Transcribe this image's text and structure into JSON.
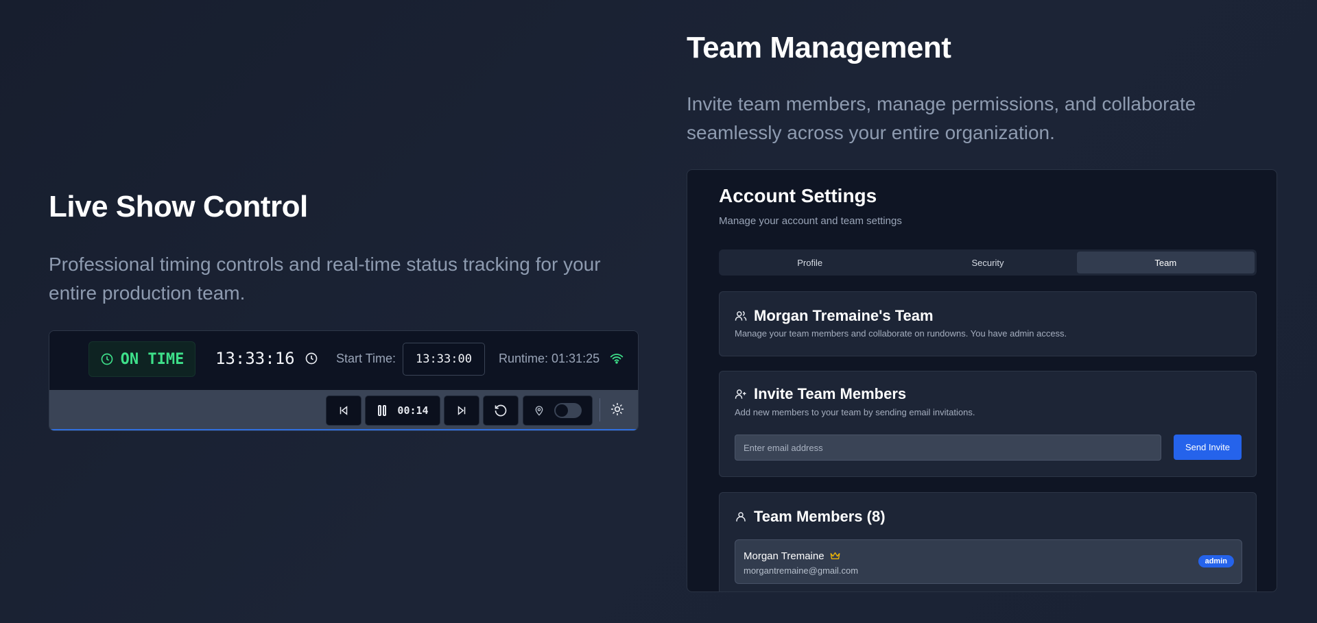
{
  "left": {
    "title": "Live Show Control",
    "description": "Professional timing controls and real-time status tracking for your entire production team.",
    "control": {
      "status": "ON TIME",
      "clock": "13:33:16",
      "start_label": "Start Time:",
      "start_value": "13:33:00",
      "runtime": "Runtime: 01:31:25",
      "timer": "00:14",
      "status_color": "#3ee08a"
    }
  },
  "right": {
    "title": "Team Management",
    "description": "Invite team members, manage permissions, and collaborate seamlessly across your entire organization.",
    "panel": {
      "title": "Account Settings",
      "subtitle": "Manage your account and team settings",
      "tabs": [
        {
          "label": "Profile"
        },
        {
          "label": "Security"
        },
        {
          "label": "Team"
        }
      ],
      "active_tab": "Team",
      "team_card": {
        "title": "Morgan Tremaine's Team",
        "description": "Manage your team members and collaborate on rundowns. You have admin access."
      },
      "invite_card": {
        "title": "Invite Team Members",
        "description": "Add new members to your team by sending email invitations.",
        "placeholder": "Enter email address",
        "button": "Send Invite"
      },
      "members_card": {
        "title": "Team Members (8)",
        "members": [
          {
            "name": "Morgan Tremaine",
            "email": "morgantremaine@gmail.com",
            "role": "admin"
          }
        ]
      }
    },
    "accent_color": "#2563eb"
  }
}
